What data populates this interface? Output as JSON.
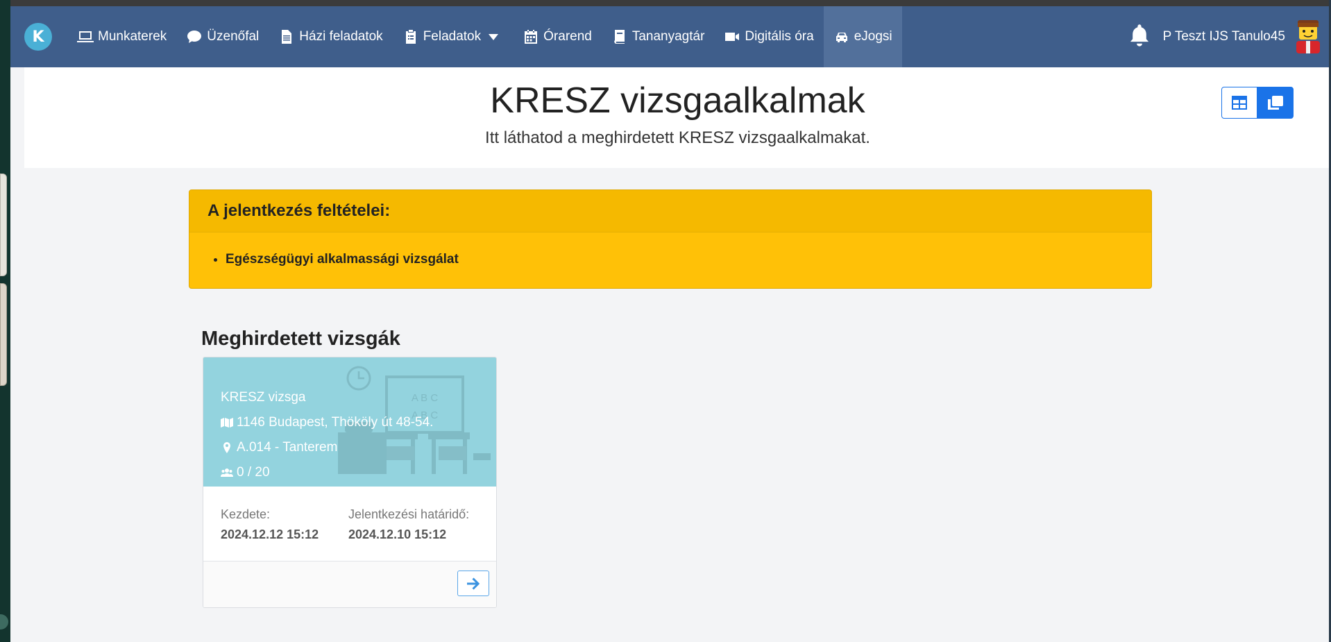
{
  "nav": {
    "items": [
      {
        "label": "Munkaterek",
        "icon": "laptop-icon"
      },
      {
        "label": "Üzenőfal",
        "icon": "chat-icon"
      },
      {
        "label": "Házi feladatok",
        "icon": "document-icon"
      },
      {
        "label": "Feladatok",
        "icon": "clipboard-icon"
      },
      {
        "label": "Órarend",
        "icon": "calendar-icon"
      },
      {
        "label": "Tananyagtár",
        "icon": "book-icon"
      },
      {
        "label": "Digitális óra",
        "icon": "video-icon"
      },
      {
        "label": "eJogsi",
        "icon": "car-icon"
      }
    ],
    "active": "eJogsi",
    "username": "P Teszt IJS Tanulo45"
  },
  "header": {
    "title": "KRESZ vizsgaalkalmak",
    "subtitle": "Itt láthatod a meghirdetett KRESZ vizsgaalkalmakat."
  },
  "alert": {
    "title": "A jelentkezés feltételei:",
    "items": [
      "Egészségügyi alkalmassági vizsgálat"
    ]
  },
  "exams": {
    "section_title": "Meghirdetett vizsgák",
    "cards": [
      {
        "name": "KRESZ vizsga",
        "address": "1146 Budapest, Thököly út 48-54.",
        "room": "A.014 - Tanterem",
        "capacity": "0 / 20",
        "start_label": "Kezdete:",
        "start_value": "2024.12.12 15:12",
        "deadline_label": "Jelentkezési határidő:",
        "deadline_value": "2024.12.10 15:12",
        "illustration_text": [
          "A B C",
          "A B C"
        ]
      }
    ]
  },
  "colors": {
    "navbar": "#3f5e8b",
    "alert": "#ffc107",
    "card_top": "#93d3de",
    "accent": "#1a73e8"
  }
}
